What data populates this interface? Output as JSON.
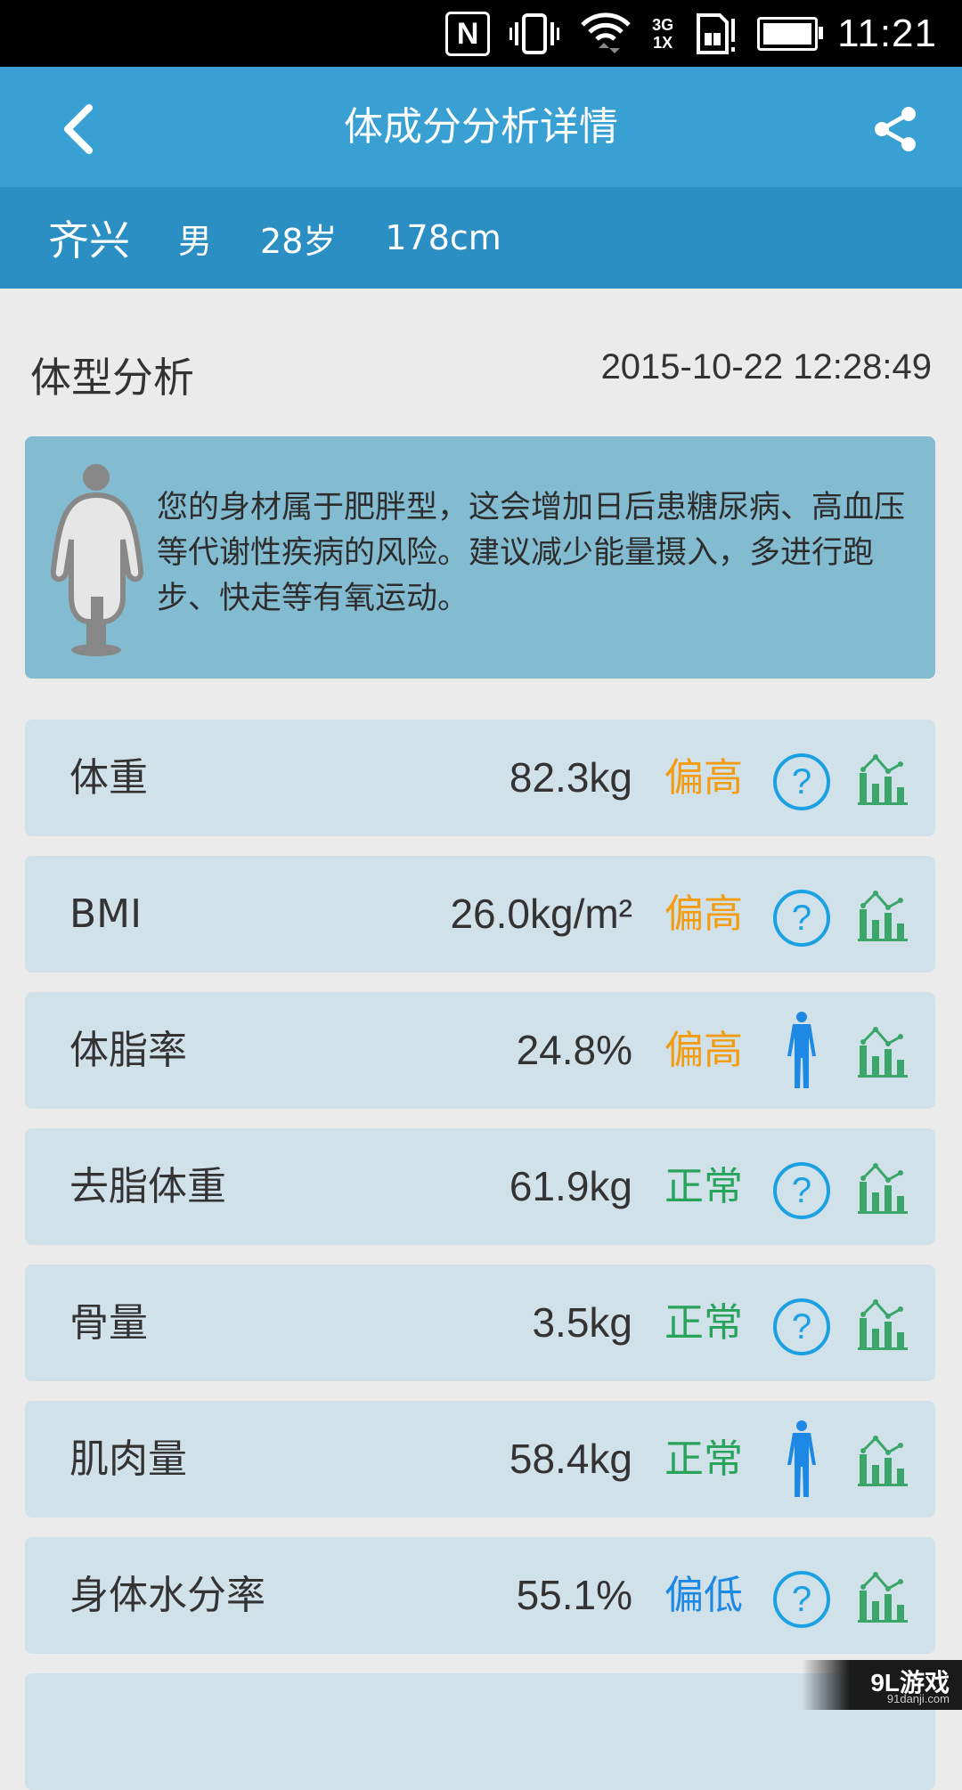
{
  "status_bar": {
    "time": "11:21",
    "nfc": "N",
    "net_top": "3G",
    "net_bottom": "1X",
    "icons": [
      "nfc-icon",
      "vibrate-icon",
      "wifi-icon",
      "signal-icon",
      "sim-alert-icon",
      "battery-icon"
    ]
  },
  "app_bar": {
    "title": "体成分分析详情",
    "back_icon": "back-arrow-icon",
    "share_icon": "share-icon"
  },
  "user": {
    "name": "齐兴",
    "sex": "男",
    "age": "28岁",
    "height": "178cm"
  },
  "section": {
    "title": "体型分析",
    "datetime": "2015-10-22 12:28:49"
  },
  "advice": {
    "text": "您的身材属于肥胖型，这会增加日后患糖尿病、高血压等代谢性疾病的风险。建议减少能量摄入，多进行跑步、快走等有氧运动。",
    "figure_icon": "body-figure-icon"
  },
  "colors": {
    "high": "#f39c12",
    "normal": "#27a35a",
    "low": "#1e88e5",
    "app_bar": "#38a0d3",
    "user_bar": "#2c8fc3"
  },
  "metrics": [
    {
      "label": "体重",
      "value": "82.3kg",
      "status": "偏高",
      "level": "high",
      "action": "help"
    },
    {
      "label": "BMI",
      "value": "26.0kg/m²",
      "status": "偏高",
      "level": "high",
      "action": "help"
    },
    {
      "label": "体脂率",
      "value": "24.8%",
      "status": "偏高",
      "level": "high",
      "action": "body"
    },
    {
      "label": "去脂体重",
      "value": "61.9kg",
      "status": "正常",
      "level": "normal",
      "action": "help"
    },
    {
      "label": "骨量",
      "value": "3.5kg",
      "status": "正常",
      "level": "normal",
      "action": "help"
    },
    {
      "label": "肌肉量",
      "value": "58.4kg",
      "status": "正常",
      "level": "normal",
      "action": "body"
    },
    {
      "label": "身体水分率",
      "value": "55.1%",
      "status": "偏低",
      "level": "low",
      "action": "help"
    }
  ],
  "help_glyph": "?",
  "watermark": {
    "brand": "9L游戏",
    "url": "91danji.com"
  }
}
